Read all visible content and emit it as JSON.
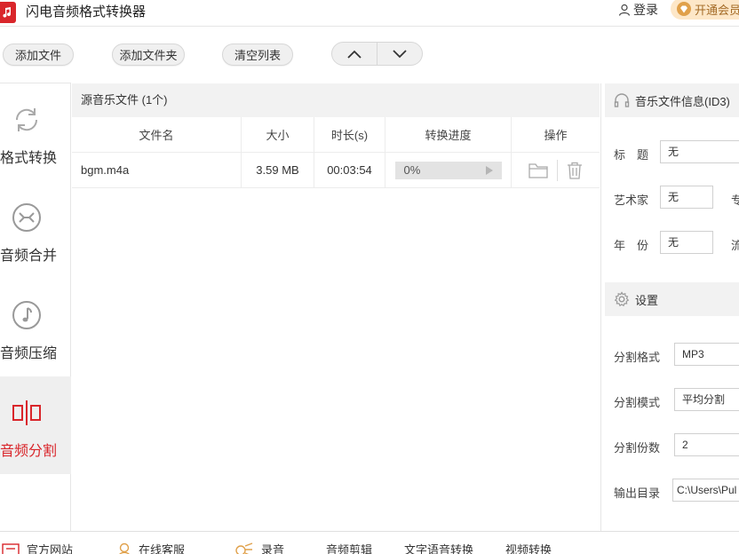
{
  "app": {
    "title": "闪电音频格式转换器"
  },
  "header": {
    "login_label": "登录",
    "vip_label": "开通会员"
  },
  "toolbar": {
    "add_file": "添加文件",
    "add_folder": "添加文件夹",
    "clear_list": "清空列表"
  },
  "sidebar": {
    "items": [
      {
        "label": "格式转换",
        "icon": "refresh-icon"
      },
      {
        "label": "音频合并",
        "icon": "merge-icon"
      },
      {
        "label": "音频压缩",
        "icon": "music-note-icon"
      },
      {
        "label": "音频分割",
        "icon": "split-icon",
        "active": true
      }
    ]
  },
  "filelist": {
    "header": "源音乐文件 (1个)",
    "columns": [
      "文件名",
      "大小",
      "时长(s)",
      "转换进度",
      "操作"
    ],
    "rows": [
      {
        "name": "bgm.m4a",
        "size": "3.59 MB",
        "duration": "00:03:54",
        "progress": "0%"
      }
    ]
  },
  "info": {
    "header": "音乐文件信息(ID3)",
    "title_label": "标　题",
    "title_value": "无",
    "artist_label": "艺术家",
    "artist_value": "无",
    "artist_extra": "专",
    "year_label": "年　份",
    "year_value": "无",
    "year_extra": "流"
  },
  "settings": {
    "header": "设置",
    "format_label": "分割格式",
    "format_value": "MP3",
    "mode_label": "分割模式",
    "mode_value": "平均分割",
    "count_label": "分割份数",
    "count_value": "2",
    "output_label": "输出目录",
    "output_value": "C:\\Users\\Pul"
  },
  "bottom": {
    "website": "官方网站",
    "support": "在线客服",
    "record": "录音",
    "audio_edit": "音频剪辑",
    "tts": "文字语音转换",
    "video": "视频转换"
  },
  "colors": {
    "accent": "#d9262b",
    "vip_bg": "#fde7c8",
    "vip_text": "#a36a25"
  }
}
